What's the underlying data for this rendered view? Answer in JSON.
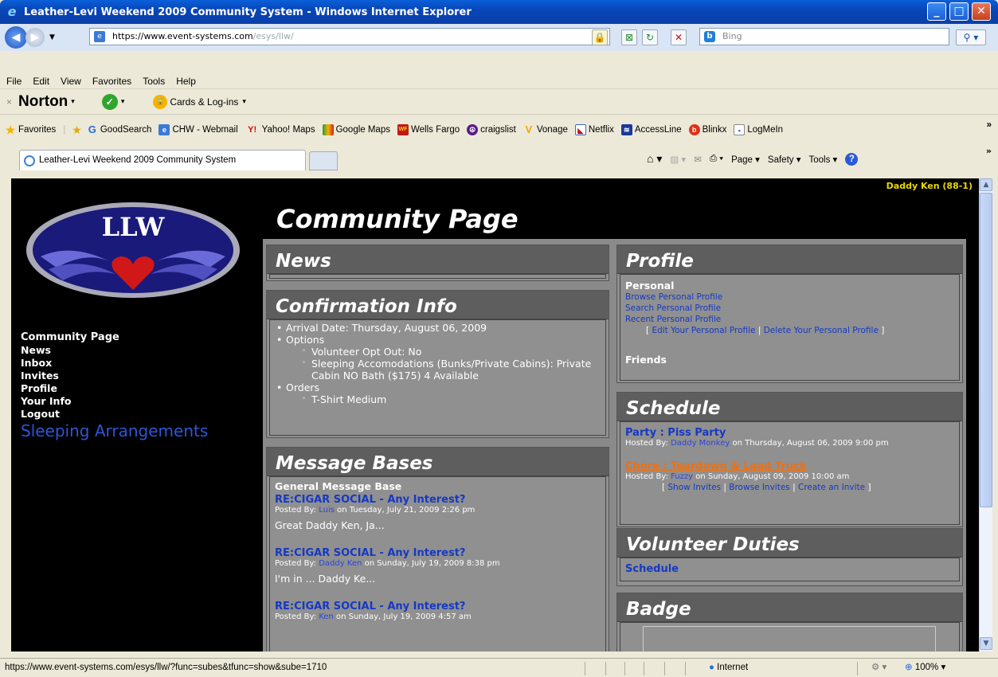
{
  "window": {
    "title": "Leather-Levi Weekend 2009 Community System - Windows Internet Explorer"
  },
  "address": {
    "url_prefix": "https://",
    "url_host": "www.event-systems.com",
    "url_path": "/esys/llw/"
  },
  "search": {
    "placeholder": "Bing"
  },
  "menu": [
    "File",
    "Edit",
    "View",
    "Favorites",
    "Tools",
    "Help"
  ],
  "norton": {
    "brand": "Norton",
    "cards": "Cards & Log-ins"
  },
  "favorites": {
    "label": "Favorites",
    "items": [
      "GoodSearch",
      "CHW - Webmail",
      "Yahoo! Maps",
      "Google Maps",
      "Wells Fargo",
      "craigslist",
      "Vonage",
      "Netflix",
      "AccessLine",
      "Blinkx",
      "LogMeIn"
    ]
  },
  "tab": {
    "label": "Leather-Levi Weekend 2009 Community System"
  },
  "commandbar": {
    "page": "Page",
    "safety": "Safety",
    "tools": "Tools"
  },
  "page": {
    "user": "Daddy Ken (88-1)",
    "logo_text": "LLW",
    "title": "Community Page",
    "nav": [
      "Community Page",
      "News",
      "Inbox",
      "Invites",
      "Profile",
      "Your Info",
      "Logout"
    ],
    "sleeping": "Sleeping Arrangements"
  },
  "news": {
    "title": "News"
  },
  "confirmation": {
    "title": "Confirmation Info",
    "arrival": "Arrival Date: Thursday, August 06, 2009",
    "options_label": "Options",
    "opt_out": "Volunteer Opt Out: No",
    "sleeping": "Sleeping Accomodations (Bunks/Private Cabins): Private Cabin NO Bath ($175) 4 Available",
    "orders_label": "Orders",
    "order_item": "T-Shirt Medium"
  },
  "messages": {
    "title": "Message Bases",
    "base": "General Message Base",
    "posts": [
      {
        "title": "RE:CIGAR SOCIAL - Any Interest?",
        "by_label": "Posted By:",
        "author": "Luis",
        "when": "on Tuesday, July 21, 2009 2:26 pm",
        "excerpt": "Great Daddy Ken, Ja..."
      },
      {
        "title": "RE:CIGAR SOCIAL - Any Interest?",
        "by_label": "Posted By:",
        "author": "Daddy Ken",
        "when": "on Sunday, July 19, 2009 8:38 pm",
        "excerpt": "I'm in ... Daddy Ke..."
      },
      {
        "title": "RE:CIGAR SOCIAL - Any Interest?",
        "by_label": "Posted By:",
        "author": "Ken",
        "when": "on Sunday, July 19, 2009 4:57 am",
        "excerpt": ""
      }
    ]
  },
  "profile": {
    "title": "Profile",
    "personal": "Personal",
    "browse": "Browse Personal Profile",
    "search": "Search Personal Profile",
    "recent": "Recent Personal Profile",
    "edit": "Edit Your Personal Profile",
    "delete": "Delete Your Personal Profile",
    "friends": "Friends"
  },
  "schedule": {
    "title": "Schedule",
    "events": [
      {
        "title": "Party : Piss Party",
        "by_label": "Hosted By:",
        "host": "Daddy Monkey",
        "when": "on Thursday, August 06, 2009 9:00 pm"
      },
      {
        "title": "Chore : Teardown & Load Truck",
        "by_label": "Hosted By:",
        "host": "Fuzzy",
        "when": "on Sunday, August 09, 2009 10:00 am"
      }
    ],
    "show_invites": "Show Invites",
    "browse_invites": "Browse Invites",
    "create_invite": "Create an Invite"
  },
  "volunteer": {
    "title": "Volunteer Duties",
    "schedule": "Schedule"
  },
  "badge": {
    "title": "Badge"
  },
  "status": {
    "url": "https://www.event-systems.com/esys/llw/?func=subes&tfunc=show&sube=1710",
    "zone": "Internet",
    "zoom": "100%"
  },
  "colors": {
    "accent_link": "#1539c4",
    "user_yellow": "#e8d800",
    "chore_orange": "#f07010",
    "panel_grey": "#909090",
    "header_grey": "#5e5e5e"
  }
}
